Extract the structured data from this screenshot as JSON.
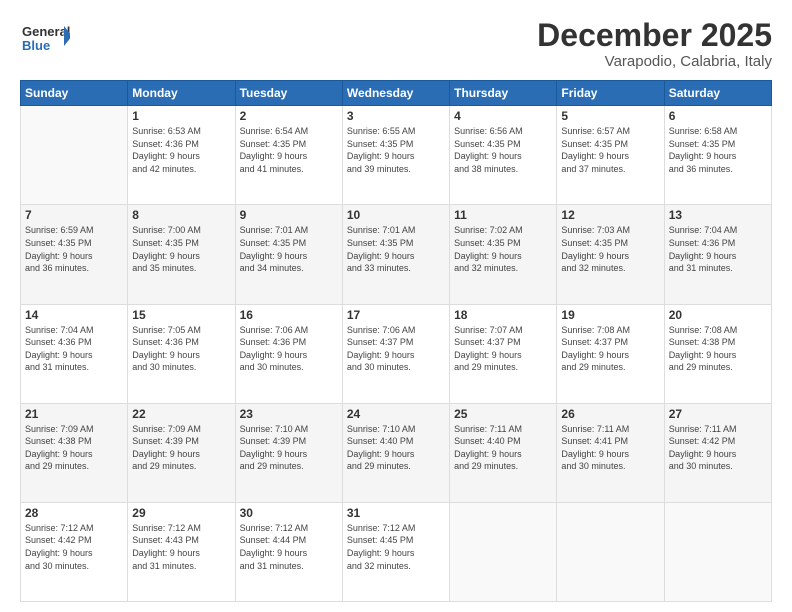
{
  "header": {
    "logo_line1": "General",
    "logo_line2": "Blue",
    "title": "December 2025",
    "subtitle": "Varapodio, Calabria, Italy"
  },
  "days_of_week": [
    "Sunday",
    "Monday",
    "Tuesday",
    "Wednesday",
    "Thursday",
    "Friday",
    "Saturday"
  ],
  "weeks": [
    [
      {
        "day": "",
        "info": ""
      },
      {
        "day": "1",
        "info": "Sunrise: 6:53 AM\nSunset: 4:36 PM\nDaylight: 9 hours\nand 42 minutes."
      },
      {
        "day": "2",
        "info": "Sunrise: 6:54 AM\nSunset: 4:35 PM\nDaylight: 9 hours\nand 41 minutes."
      },
      {
        "day": "3",
        "info": "Sunrise: 6:55 AM\nSunset: 4:35 PM\nDaylight: 9 hours\nand 39 minutes."
      },
      {
        "day": "4",
        "info": "Sunrise: 6:56 AM\nSunset: 4:35 PM\nDaylight: 9 hours\nand 38 minutes."
      },
      {
        "day": "5",
        "info": "Sunrise: 6:57 AM\nSunset: 4:35 PM\nDaylight: 9 hours\nand 37 minutes."
      },
      {
        "day": "6",
        "info": "Sunrise: 6:58 AM\nSunset: 4:35 PM\nDaylight: 9 hours\nand 36 minutes."
      }
    ],
    [
      {
        "day": "7",
        "info": "Sunrise: 6:59 AM\nSunset: 4:35 PM\nDaylight: 9 hours\nand 36 minutes."
      },
      {
        "day": "8",
        "info": "Sunrise: 7:00 AM\nSunset: 4:35 PM\nDaylight: 9 hours\nand 35 minutes."
      },
      {
        "day": "9",
        "info": "Sunrise: 7:01 AM\nSunset: 4:35 PM\nDaylight: 9 hours\nand 34 minutes."
      },
      {
        "day": "10",
        "info": "Sunrise: 7:01 AM\nSunset: 4:35 PM\nDaylight: 9 hours\nand 33 minutes."
      },
      {
        "day": "11",
        "info": "Sunrise: 7:02 AM\nSunset: 4:35 PM\nDaylight: 9 hours\nand 32 minutes."
      },
      {
        "day": "12",
        "info": "Sunrise: 7:03 AM\nSunset: 4:35 PM\nDaylight: 9 hours\nand 32 minutes."
      },
      {
        "day": "13",
        "info": "Sunrise: 7:04 AM\nSunset: 4:36 PM\nDaylight: 9 hours\nand 31 minutes."
      }
    ],
    [
      {
        "day": "14",
        "info": "Sunrise: 7:04 AM\nSunset: 4:36 PM\nDaylight: 9 hours\nand 31 minutes."
      },
      {
        "day": "15",
        "info": "Sunrise: 7:05 AM\nSunset: 4:36 PM\nDaylight: 9 hours\nand 30 minutes."
      },
      {
        "day": "16",
        "info": "Sunrise: 7:06 AM\nSunset: 4:36 PM\nDaylight: 9 hours\nand 30 minutes."
      },
      {
        "day": "17",
        "info": "Sunrise: 7:06 AM\nSunset: 4:37 PM\nDaylight: 9 hours\nand 30 minutes."
      },
      {
        "day": "18",
        "info": "Sunrise: 7:07 AM\nSunset: 4:37 PM\nDaylight: 9 hours\nand 29 minutes."
      },
      {
        "day": "19",
        "info": "Sunrise: 7:08 AM\nSunset: 4:37 PM\nDaylight: 9 hours\nand 29 minutes."
      },
      {
        "day": "20",
        "info": "Sunrise: 7:08 AM\nSunset: 4:38 PM\nDaylight: 9 hours\nand 29 minutes."
      }
    ],
    [
      {
        "day": "21",
        "info": "Sunrise: 7:09 AM\nSunset: 4:38 PM\nDaylight: 9 hours\nand 29 minutes."
      },
      {
        "day": "22",
        "info": "Sunrise: 7:09 AM\nSunset: 4:39 PM\nDaylight: 9 hours\nand 29 minutes."
      },
      {
        "day": "23",
        "info": "Sunrise: 7:10 AM\nSunset: 4:39 PM\nDaylight: 9 hours\nand 29 minutes."
      },
      {
        "day": "24",
        "info": "Sunrise: 7:10 AM\nSunset: 4:40 PM\nDaylight: 9 hours\nand 29 minutes."
      },
      {
        "day": "25",
        "info": "Sunrise: 7:11 AM\nSunset: 4:40 PM\nDaylight: 9 hours\nand 29 minutes."
      },
      {
        "day": "26",
        "info": "Sunrise: 7:11 AM\nSunset: 4:41 PM\nDaylight: 9 hours\nand 30 minutes."
      },
      {
        "day": "27",
        "info": "Sunrise: 7:11 AM\nSunset: 4:42 PM\nDaylight: 9 hours\nand 30 minutes."
      }
    ],
    [
      {
        "day": "28",
        "info": "Sunrise: 7:12 AM\nSunset: 4:42 PM\nDaylight: 9 hours\nand 30 minutes."
      },
      {
        "day": "29",
        "info": "Sunrise: 7:12 AM\nSunset: 4:43 PM\nDaylight: 9 hours\nand 31 minutes."
      },
      {
        "day": "30",
        "info": "Sunrise: 7:12 AM\nSunset: 4:44 PM\nDaylight: 9 hours\nand 31 minutes."
      },
      {
        "day": "31",
        "info": "Sunrise: 7:12 AM\nSunset: 4:45 PM\nDaylight: 9 hours\nand 32 minutes."
      },
      {
        "day": "",
        "info": ""
      },
      {
        "day": "",
        "info": ""
      },
      {
        "day": "",
        "info": ""
      }
    ]
  ]
}
